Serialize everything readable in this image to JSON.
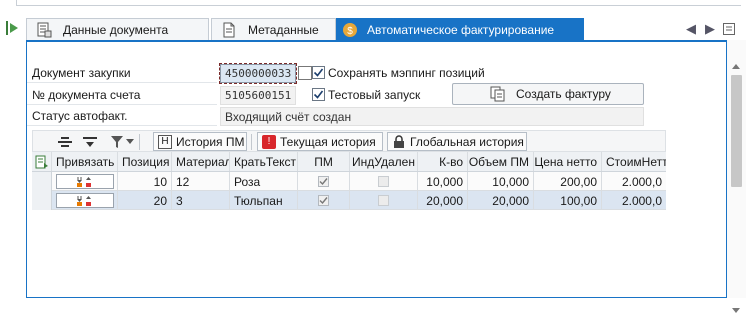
{
  "tabs": [
    {
      "label": "Данные документа",
      "icon": "document-data-icon",
      "active": false
    },
    {
      "label": "Метаданные",
      "icon": "metadata-icon",
      "active": false
    },
    {
      "label": "Автоматическое фактурирование",
      "icon": "auto-invoicing-icon",
      "active": true
    }
  ],
  "form": {
    "po_label": "Документ закупки",
    "po_value": "4500000033",
    "invoice_label": "№ документа счета",
    "invoice_value": "5105600151",
    "status_label": "Статус автофакт.",
    "status_value": "Входящий счёт создан",
    "save_mapping_label": "Сохранять мэппинг позиций",
    "save_mapping_checked": true,
    "test_run_label": "Тестовый запуск",
    "test_run_checked": true,
    "create_invoice_label": "Создать фактуру"
  },
  "toolbar": {
    "history_pm": "История ПМ",
    "current_history": "Текущая история",
    "global_history": "Глобальная история"
  },
  "table": {
    "headers": [
      "Привязать",
      "Позиция",
      "Материал",
      "КратьТекст",
      "ПМ",
      "ИндУдален",
      "К-во",
      "Объем ПМ",
      "Цена нетто",
      "СтоимНетт"
    ],
    "rows": [
      {
        "pos": "10",
        "material": "12",
        "text": "Роза",
        "pm": true,
        "deleted": false,
        "qty": "10,000",
        "pm_qty": "10,000",
        "price": "200,00",
        "value": "2.000,0"
      },
      {
        "pos": "20",
        "material": "3",
        "text": "Тюльпан",
        "pm": true,
        "deleted": false,
        "qty": "20,000",
        "pm_qty": "20,000",
        "price": "100,00",
        "value": "2.000,0"
      }
    ]
  },
  "colors": {
    "accent": "#1873c6",
    "selected_row": "#dbe5f1"
  }
}
